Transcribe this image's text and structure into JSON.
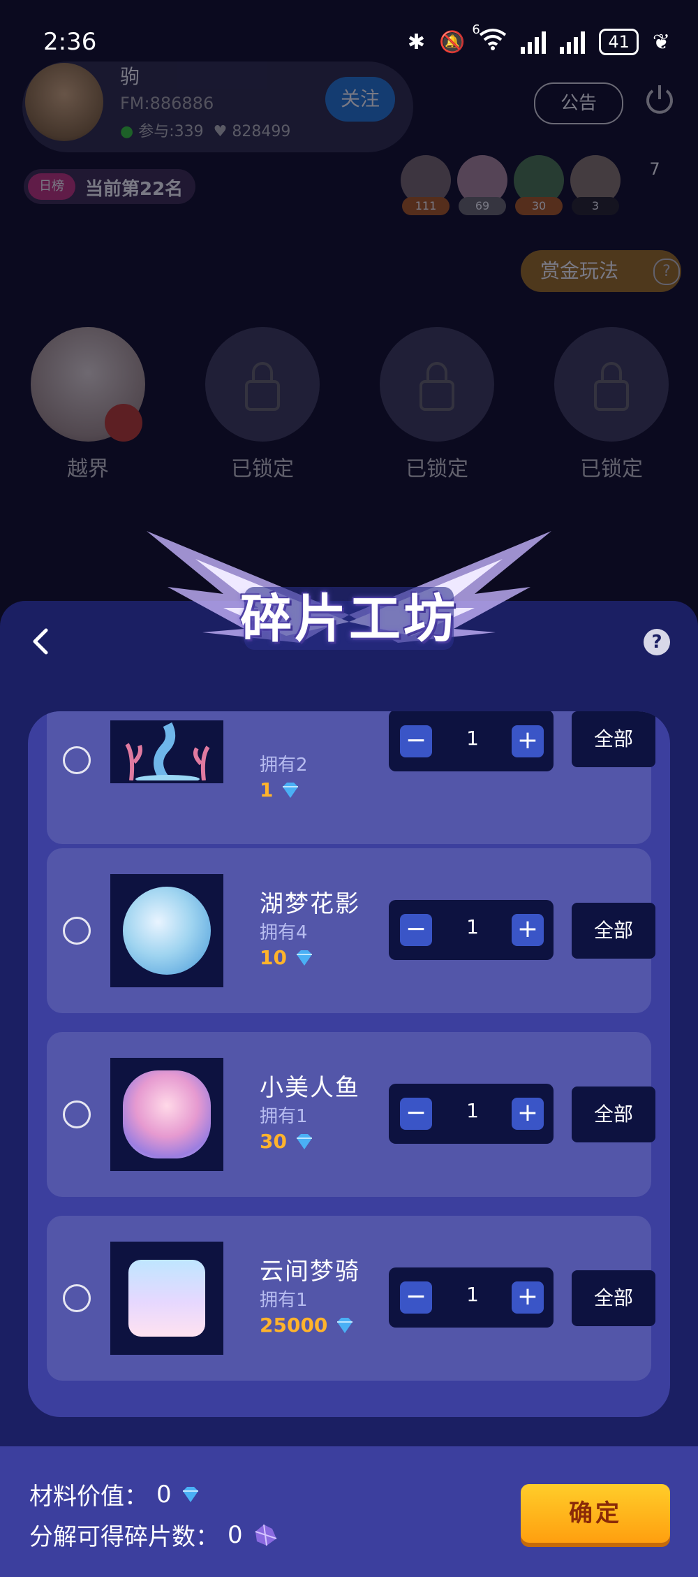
{
  "status_bar": {
    "time": "2:36",
    "battery": "41",
    "network": "6"
  },
  "room": {
    "host": {
      "name": "驹",
      "fm_id": "FM:886886",
      "participants": "参与:339",
      "likes": "828499"
    },
    "follow_label": "关注",
    "notice_label": "公告",
    "rank": {
      "tag": "日榜",
      "text": "当前第22名"
    },
    "fans": [
      "111",
      "69",
      "30",
      "3"
    ],
    "fan_total": "7",
    "bounty_label": "赏金玩法",
    "seats": [
      "越界",
      "已锁定",
      "已锁定",
      "已锁定"
    ]
  },
  "dialog": {
    "title": "碎片工坊",
    "items": [
      {
        "name": "",
        "owned": "拥有2",
        "price": "1",
        "qty": "1",
        "all_label": "全部"
      },
      {
        "name": "湖梦花影",
        "owned": "拥有4",
        "price": "10",
        "qty": "1",
        "all_label": "全部"
      },
      {
        "name": "小美人鱼",
        "owned": "拥有1",
        "price": "30",
        "qty": "1",
        "all_label": "全部"
      },
      {
        "name": "云间梦骑",
        "owned": "拥有1",
        "price": "25000",
        "qty": "1",
        "all_label": "全部"
      }
    ],
    "footer": {
      "material_label": "材料价值：",
      "material_value": "0",
      "shards_label": "分解可得碎片数：",
      "shards_value": "0",
      "confirm_label": "确定"
    }
  },
  "colors": {
    "sheet": "#1b1f63",
    "card": "#3c3f9e",
    "item": "#5356a9",
    "price": "#ffb32c",
    "confirm": "#ffb41c"
  }
}
